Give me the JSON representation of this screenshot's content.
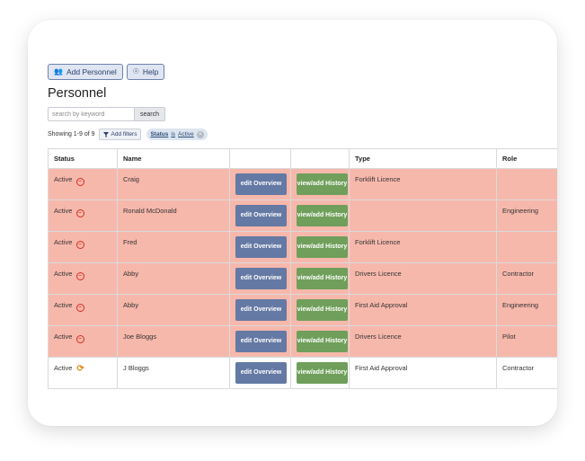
{
  "toolbar": {
    "add_label": "Add Personnel",
    "help_label": "Help"
  },
  "page_title": "Personnel",
  "search": {
    "placeholder": "search by keyword",
    "button_label": "search"
  },
  "filters": {
    "showing": "Showing 1-9 of 9",
    "add_filters_label": "Add filters",
    "chip_field": "Status",
    "chip_op": "is",
    "chip_value": "Active"
  },
  "table": {
    "headers": [
      "Status",
      "Name",
      "",
      "",
      "Type",
      "Role"
    ],
    "rows": [
      {
        "status": "Active",
        "icon": "expired-icon",
        "name": "Craig",
        "edit": "edit Overview",
        "history": "view/add History",
        "type": "Forklift Licence",
        "role": ""
      },
      {
        "status": "Active",
        "icon": "expired-icon",
        "name": "Ronald McDonald",
        "edit": "edit Overview",
        "history": "view/add History",
        "type": "",
        "role": "Engineering"
      },
      {
        "status": "Active",
        "icon": "expired-icon",
        "name": "Fred",
        "edit": "edit Overview",
        "history": "view/add History",
        "type": "Forklift Licence",
        "role": ""
      },
      {
        "status": "Active",
        "icon": "expired-icon",
        "name": "Abby",
        "edit": "edit Overview",
        "history": "view/add History",
        "type": "Drivers Licence",
        "role": "Contractor"
      },
      {
        "status": "Active",
        "icon": "expired-icon",
        "name": "Abby",
        "edit": "edit Overview",
        "history": "view/add History",
        "type": "First Aid Approval",
        "role": "Engineering"
      },
      {
        "status": "Active",
        "icon": "expired-icon",
        "name": "Joe Bloggs",
        "edit": "edit Overview",
        "history": "view/add History",
        "type": "Drivers Licence",
        "role": "Pilot"
      },
      {
        "status": "Active",
        "icon": "renew-icon",
        "name": "J Bloggs",
        "edit": "edit Overview",
        "history": "view/add History",
        "type": "First Aid Approval",
        "role": "Contractor"
      }
    ]
  },
  "colors": {
    "expired_row": "#f7b8ac",
    "edit_button": "#6479a4",
    "history_button": "#6f9f5b",
    "expired_icon": "#d62e1c",
    "renew_icon": "#e08a1a"
  }
}
